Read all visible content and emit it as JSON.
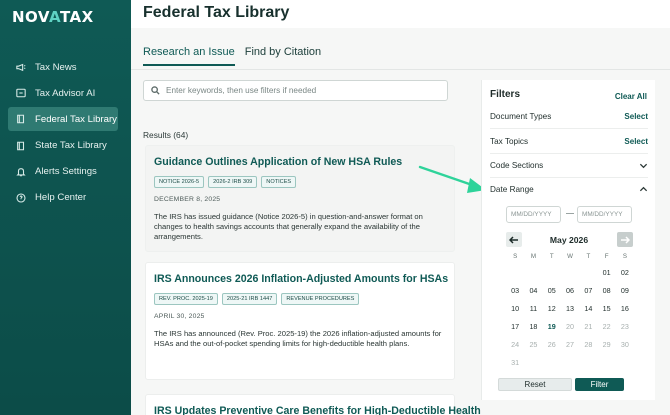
{
  "brand": {
    "logo_part1": "NOV",
    "logo_part2": "A",
    "logo_part3": "TAX"
  },
  "sidebar": {
    "items": [
      {
        "label": "Tax News",
        "icon": "megaphone-icon"
      },
      {
        "label": "Tax Advisor AI",
        "icon": "chat-icon"
      },
      {
        "label": "Federal Tax Library",
        "icon": "book-icon",
        "active": true
      },
      {
        "label": "State Tax Library",
        "icon": "book-icon"
      },
      {
        "label": "Alerts Settings",
        "icon": "bell-icon"
      },
      {
        "label": "Help Center",
        "icon": "help-icon"
      }
    ]
  },
  "header": {
    "title": "Federal Tax Library"
  },
  "tabs": [
    {
      "label": "Research an Issue",
      "active": true
    },
    {
      "label": "Find by Citation"
    }
  ],
  "search": {
    "placeholder": "Enter keywords, then use filters if needed",
    "value": ""
  },
  "results": {
    "count_label": "Results (64)",
    "items": [
      {
        "title": "Guidance Outlines Application of New HSA Rules",
        "tags": [
          "NOTICE 2026-5",
          "2026-2 IRB 309",
          "NOTICES"
        ],
        "date": "DECEMBER 8, 2025",
        "description": "The IRS has issued guidance (Notice 2026-5) in question-and-answer format on changes to health savings accounts that generally expand the availability of the arrangements."
      },
      {
        "title": "IRS Announces 2026 Inflation-Adjusted Amounts for HSAs",
        "tags": [
          "REV. PROC. 2025-19",
          "2025-21 IRB 1447",
          "REVENUE PROCEDURES"
        ],
        "date": "APRIL 30, 2025",
        "description": "The IRS has announced (Rev. Proc. 2025-19) the 2026 inflation-adjusted amounts for HSAs and the out-of-pocket spending limits for high-deductible health plans."
      },
      {
        "title": "IRS Updates Preventive Care Benefits for High-Deductible Health"
      }
    ]
  },
  "filters": {
    "heading": "Filters",
    "clear_label": "Clear All",
    "rows": [
      {
        "label": "Document Types",
        "action": "Select"
      },
      {
        "label": "Tax Topics",
        "action": "Select"
      },
      {
        "label": "Code Sections",
        "icon": "chevron-down-icon"
      },
      {
        "label": "Date Range",
        "icon": "chevron-up-icon"
      }
    ],
    "date_from_placeholder": "MM/DD/YYYY",
    "date_to_placeholder": "MM/DD/YYYY",
    "calendar": {
      "month_label": "May 2026",
      "weekdays": [
        "S",
        "M",
        "T",
        "W",
        "T",
        "F",
        "S"
      ],
      "today": "19",
      "weeks": [
        [
          "",
          "",
          "",
          "",
          "",
          "01",
          "02"
        ],
        [
          "03",
          "04",
          "05",
          "06",
          "07",
          "08",
          "09"
        ],
        [
          "10",
          "11",
          "12",
          "13",
          "14",
          "15",
          "16"
        ],
        [
          "17",
          "18",
          "19",
          "20",
          "21",
          "22",
          "23"
        ],
        [
          "24",
          "25",
          "26",
          "27",
          "28",
          "29",
          "30"
        ],
        [
          "31",
          "",
          "",
          "",
          "",
          "",
          ""
        ]
      ]
    },
    "reset_label": "Reset",
    "filter_label": "Filter"
  },
  "colors": {
    "brand": "#0f5a55",
    "accent": "#5fd3c4",
    "arrow": "#2ed39a"
  }
}
